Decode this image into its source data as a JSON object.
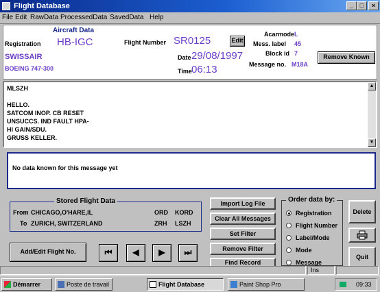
{
  "window": {
    "title": "Flight Database",
    "buttons": {
      "minimize": "_",
      "maximize": "□",
      "close": "×"
    }
  },
  "menu": [
    "File",
    "Edit",
    "RawData",
    "ProcessedData",
    "SavedData",
    "Help"
  ],
  "aircraft": {
    "heading": "Aircraft Data",
    "registration_label": "Registration",
    "registration": "HB-IGC",
    "airline": "SWISSAIR",
    "type": "BOEING 747-300"
  },
  "flight": {
    "number_label": "Flight Number",
    "number": "SR0125",
    "edit_label": "Edit",
    "date_label": "Date",
    "date": "29/08/1997",
    "time_label": "Time",
    "time": "06:13"
  },
  "acars": {
    "acarmode_label": "Acarmode",
    "acarmode": "L",
    "mess_label_label": "Mess. label",
    "mess_label": "45",
    "block_id_label": "Block id",
    "block_id": "7",
    "message_no_label": "Message no.",
    "message_no": "M18A"
  },
  "remove_known_label": "Remove Known",
  "message_lines": [
    "MLSZH",
    "",
    "HELLO.",
    "SATCOM INOP. CB RESET",
    "UNSUCCS. IND FAULT HPA-",
    "HI GAIN/SDU.",
    "GRUSS   KELLER."
  ],
  "info_text": "No data known for this message yet",
  "stored": {
    "title": "Stored Flight Data",
    "from_label": "From",
    "from_city": "CHICAGO,O'HARE,IL",
    "from_iata": "ORD",
    "from_icao": "KORD",
    "to_label": "To",
    "to_city": "ZURICH, SWITZERLAND",
    "to_iata": "ZRH",
    "to_icao": "LSZH"
  },
  "add_edit_label": "Add/Edit Flight No.",
  "nav": {
    "first": "⏮",
    "prev": "◀",
    "next": "▶",
    "last": "⏭"
  },
  "actions": [
    "Import Log File",
    "Clear All Messages",
    "Set Filter",
    "Remove Filter",
    "Find Record"
  ],
  "order": {
    "title": "Order data by:",
    "options": [
      "Registration",
      "Flight Number",
      "Label/Mode",
      "Mode",
      "Message"
    ],
    "selected": "Registration"
  },
  "side_buttons": {
    "delete": "Delete",
    "quit": "Quit"
  },
  "status": {
    "ins": "Ins"
  },
  "taskbar": {
    "start": "Démarrer",
    "items": [
      "Poste de travail",
      "Flight Database",
      "Paint Shop Pro"
    ],
    "clock": "09:33"
  },
  "colors": {
    "navy": "#1a2a8c",
    "purple": "#6a3dc8",
    "title_blue": "#0a2a8a"
  }
}
